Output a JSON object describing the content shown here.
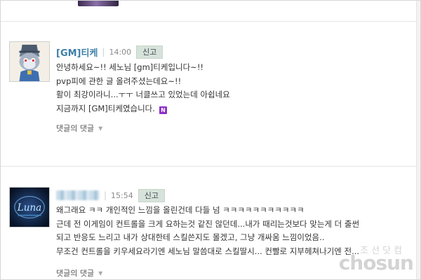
{
  "comments": [
    {
      "author": "[GM]티케",
      "time": "14:00",
      "report_label": "신고",
      "lines": [
        "안녕하세요~!! 세노님 [gm]티케입니다~!!",
        "pvp피에 관한 글 올려주셨는데요~!!",
        "활이 최강이라니...ㅜㅜ 너클쓰고 있었는데 아쉽네요",
        "지금까지 [GM]티케였습니다."
      ],
      "badge": "N",
      "reply_label": "댓글의 댓글"
    },
    {
      "author_blurred": true,
      "avatar_text": "Luna",
      "time": "15:54",
      "report_label": "신고",
      "lines": [
        "왜그래요 ㅋㅋ 개인적인 느낌을 올린건데 다들 넘 ㅋㅋㅋㅋㅋㅋㅋㅋㅋㅋㅋ",
        "근데 전 이게임이 컨트롤을 크게 요하는것 같진 않던데...내가 때리는것보다 맞는게 더 출썬",
        "되고 반응도 느리고 내가 상대한테 스킬쓴지도 몰겠고, 그냥 개싸움 느낌이었음..",
        "무조건 컨트롤을 키우세요라기엔 세노님 말씀대로 스킬딸시... 컨빨로 지부헤쳐나기엔 전..."
      ],
      "reply_label": "댓글의 댓글"
    }
  ],
  "watermark": {
    "top": "조선닷컴",
    "main": "chosun"
  },
  "icons": {
    "reply_caret": "▼"
  }
}
